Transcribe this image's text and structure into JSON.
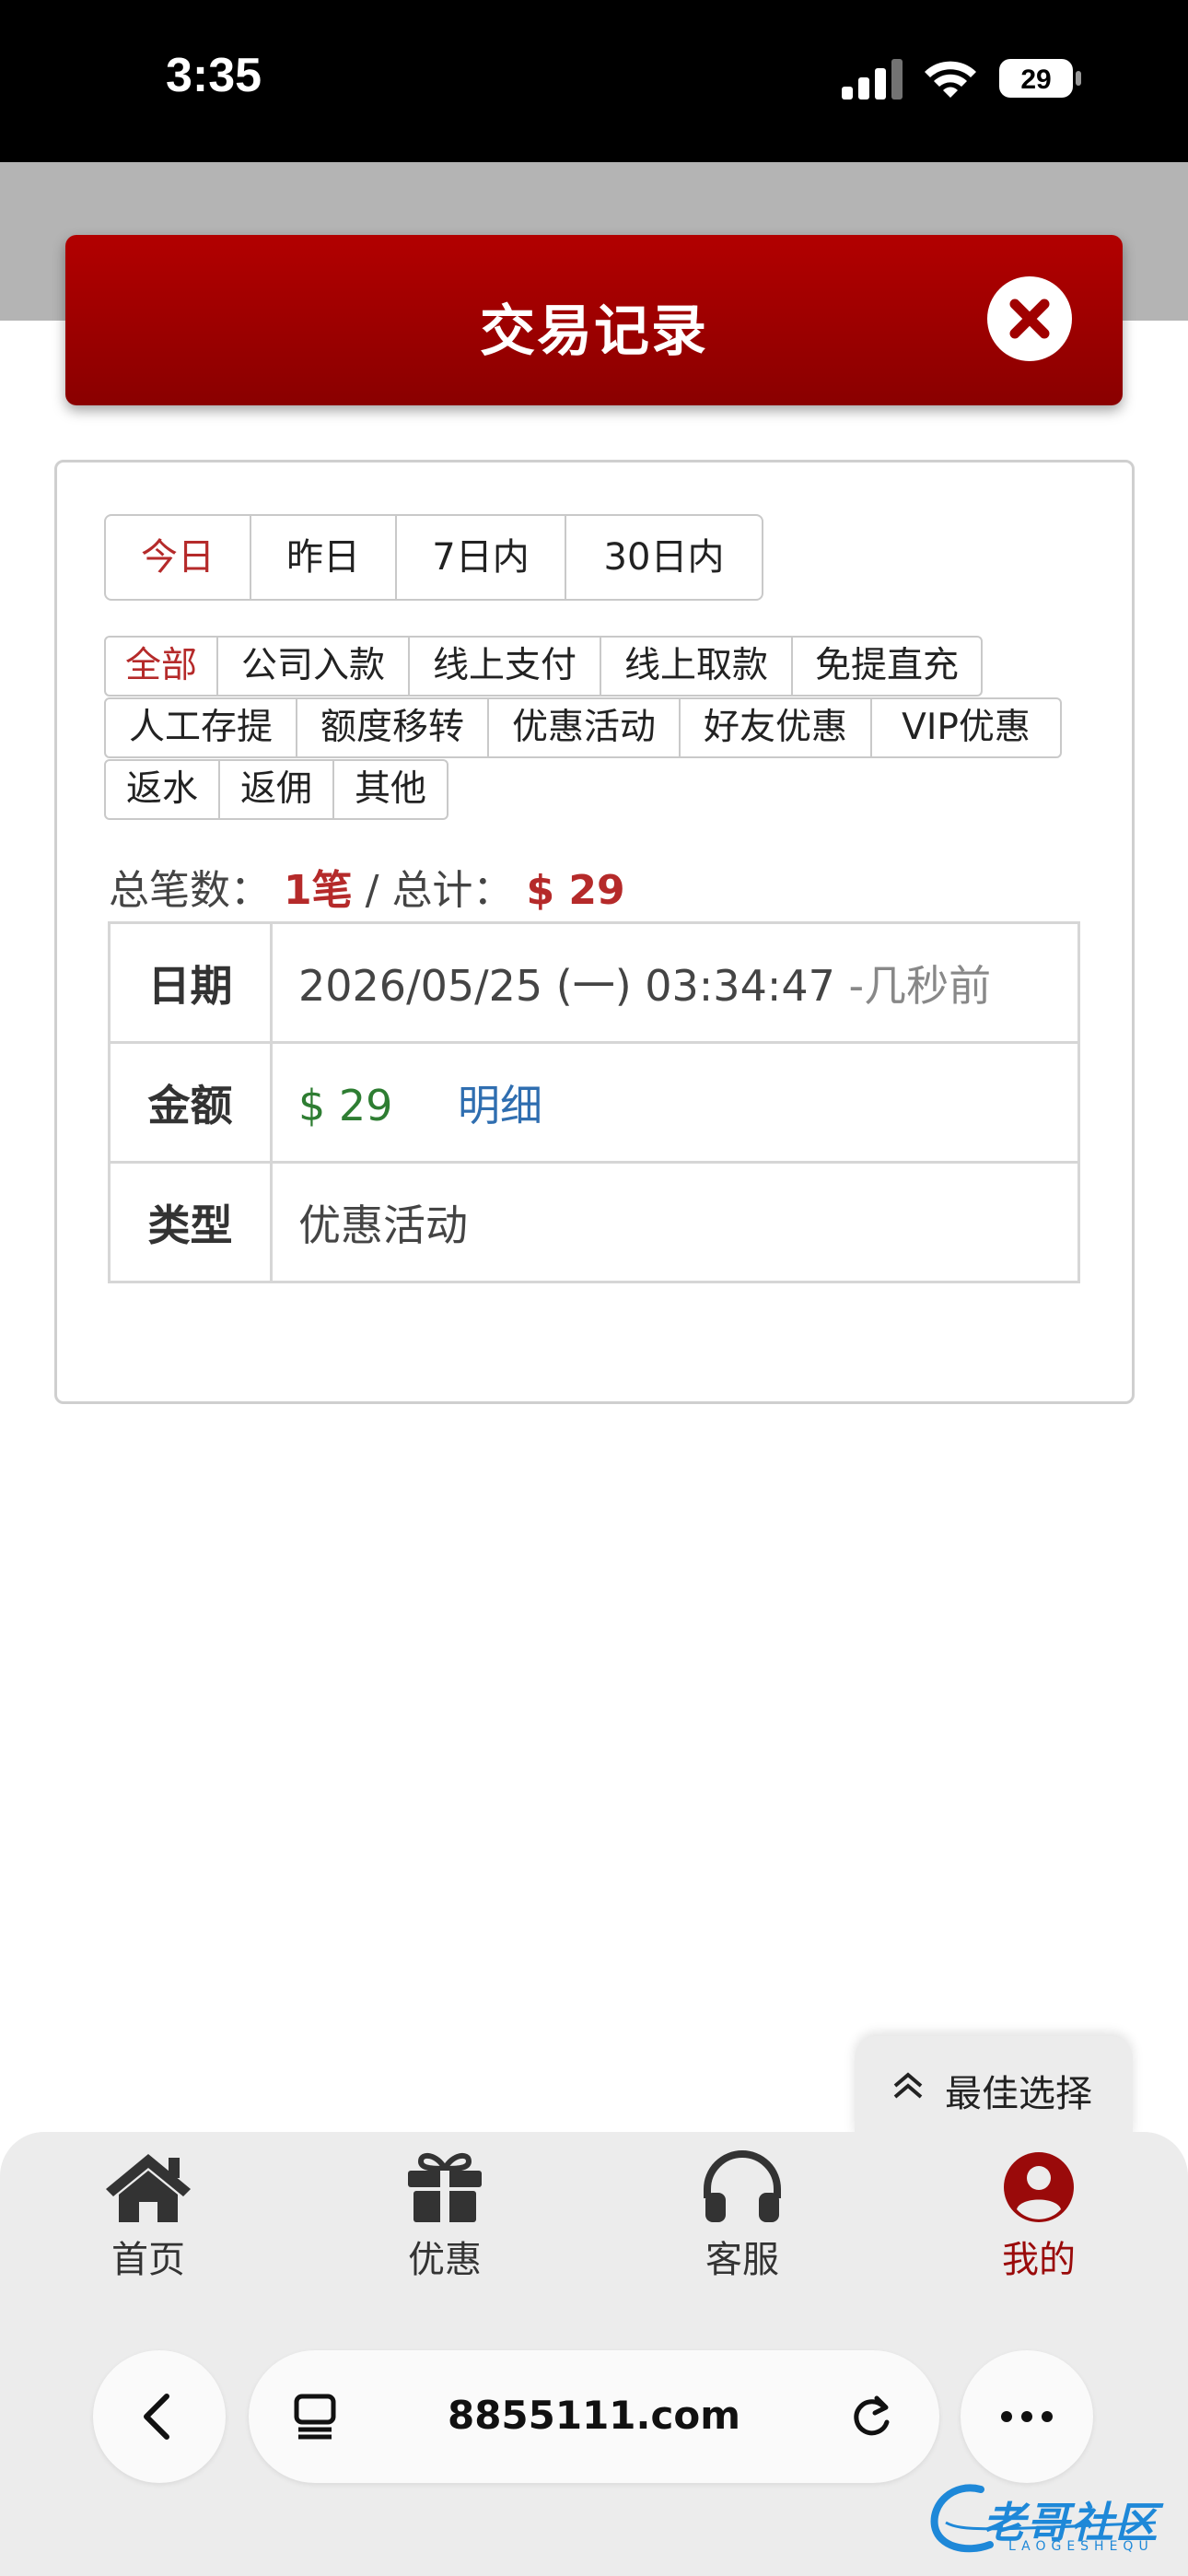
{
  "status_bar": {
    "time": "3:35",
    "battery": "29"
  },
  "modal": {
    "title": "交易记录"
  },
  "date_tabs": [
    "今日",
    "昨日",
    "7日内",
    "30日内"
  ],
  "type_filters": {
    "row1": [
      "全部",
      "公司入款",
      "线上支付",
      "线上取款",
      "免提直充"
    ],
    "row2": [
      "人工存提",
      "额度移转",
      "优惠活动",
      "好友优惠",
      "VIP优惠"
    ],
    "row3": [
      "返水",
      "返佣",
      "其他"
    ]
  },
  "summary": {
    "count_label": "总笔数：",
    "count_value": "1笔",
    "separator": " / ",
    "total_label": "总计：",
    "total_value": "$ 29"
  },
  "record": {
    "date_label": "日期",
    "date_value": "2026/05/25 (一) 03:34:47",
    "date_ago": "-几秒前",
    "amount_label": "金额",
    "amount_value": "$ 29",
    "detail_link": "明细",
    "type_label": "类型",
    "type_value": "优惠活动"
  },
  "best_choice": {
    "label": "最佳选择"
  },
  "bottom_nav": [
    "首页",
    "优惠",
    "客服",
    "我的"
  ],
  "browser": {
    "url": "8855111.com"
  },
  "watermark": {
    "text": "老哥社区",
    "sub": "LAOGESHEQU"
  },
  "colors": {
    "header_red": "#a00000",
    "active_red": "#b52a2a",
    "amount_green": "#2e7d32",
    "link_blue": "#2f6eb0"
  }
}
